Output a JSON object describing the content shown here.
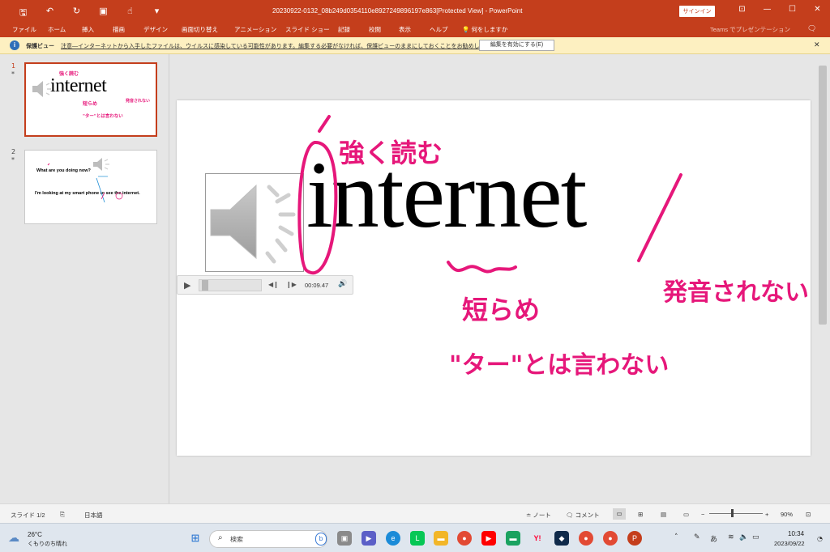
{
  "window": {
    "title": "20230922-0132_08b249d0354110e8927249896197e863[Protected View]  -  PowerPoint",
    "signin": "サインイン",
    "accent": "#c43e1c"
  },
  "ribbon": {
    "tabs": [
      "ファイル",
      "ホーム",
      "挿入",
      "描画",
      "デザイン",
      "画面切り替え",
      "アニメーション",
      "スライド ショー",
      "記録",
      "校閲",
      "表示",
      "ヘルプ"
    ],
    "tell_me": "何をしますか",
    "teams": "Teams でプレゼンテーション"
  },
  "protected_view": {
    "label": "保護ビュー",
    "message": "注意—インターネットから入手したファイルは、ウイルスに感染している可能性があります。編集する必要がなければ、保護ビューのままにしておくことをお勧めします。",
    "enable_button": "編集を有効にする(E)"
  },
  "thumbnails": [
    {
      "num": "1",
      "marker": "*",
      "word": "internet",
      "ink": [
        "強く読む",
        "短らめ",
        "発音されない",
        "\"ター\"とは言わない"
      ]
    },
    {
      "num": "2",
      "marker": "*",
      "line1": "What are you doing now?",
      "line2": "I'm looking at my smart phone to see the internet."
    }
  ],
  "slide": {
    "word": "internet",
    "ink_color": "#e6177a",
    "ink_texts": {
      "stress": "強く読む",
      "short": "短らめ",
      "silent": "発音されない",
      "not_ta": "\"ター\"とは言わない"
    }
  },
  "audio": {
    "time": "00:09.47",
    "progress": 0.05
  },
  "status": {
    "slide_of": "スライド 1/2",
    "language": "日本語",
    "notes": "ノート",
    "comments": "コメント",
    "zoom": "90%"
  },
  "taskbar": {
    "temp": "26°C",
    "weather": "くもりのち晴れ",
    "search": "検索",
    "time": "10:34",
    "date": "2023/09/22",
    "ime": "あ"
  }
}
